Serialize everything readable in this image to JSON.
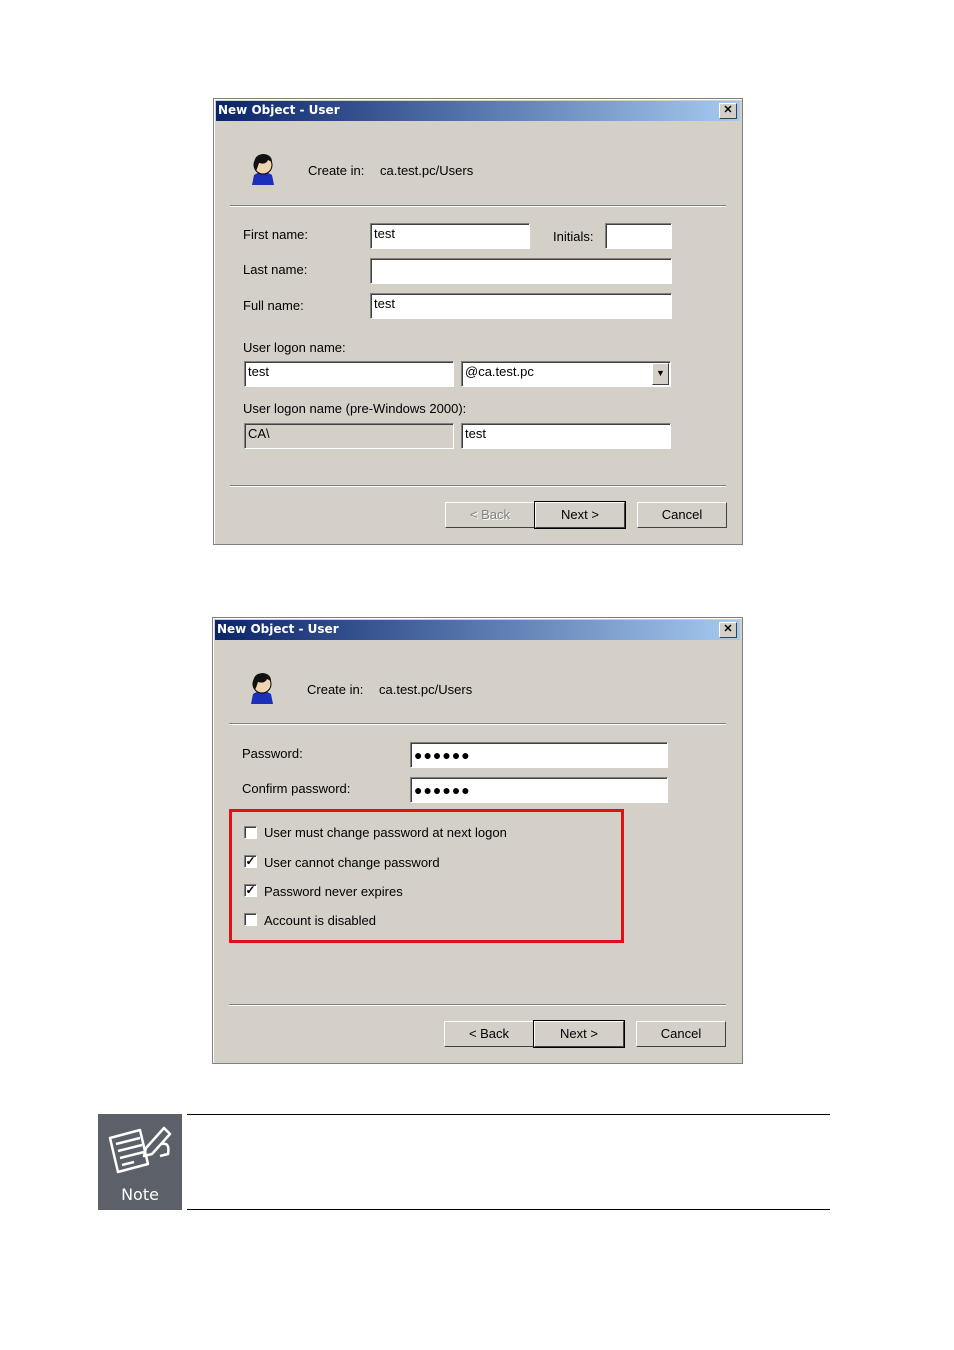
{
  "dialog1": {
    "title": "New Object - User",
    "create_in_label": "Create in:",
    "create_in_value": "ca.test.pc/Users",
    "first_name_label": "First name:",
    "first_name_value": "test",
    "initials_label": "Initials:",
    "initials_value": "",
    "last_name_label": "Last name:",
    "last_name_value": "",
    "full_name_label": "Full name:",
    "full_name_value": "test",
    "logon_label": "User logon name:",
    "logon_value": "test",
    "domain_value": "@ca.test.pc",
    "pre2000_label": "User logon name (pre-Windows 2000):",
    "pre2000_domain": "CA\\",
    "pre2000_value": "test",
    "back_label": "< Back",
    "next_label": "Next >",
    "cancel_label": "Cancel"
  },
  "dialog2": {
    "title": "New Object - User",
    "create_in_label": "Create in:",
    "create_in_value": "ca.test.pc/Users",
    "password_label": "Password:",
    "password_value": "●●●●●●",
    "confirm_label": "Confirm password:",
    "confirm_value": "●●●●●●",
    "options": [
      {
        "label": "User must change password at next logon",
        "checked": false
      },
      {
        "label": "User cannot change password",
        "checked": true
      },
      {
        "label": "Password never expires",
        "checked": true
      },
      {
        "label": "Account is disabled",
        "checked": false
      }
    ],
    "back_label": "< Back",
    "next_label": "Next >",
    "cancel_label": "Cancel"
  },
  "close_glyph": "✕",
  "check_glyph": "✓",
  "combo_arrow_glyph": "▼",
  "note": {
    "label": "Note"
  }
}
